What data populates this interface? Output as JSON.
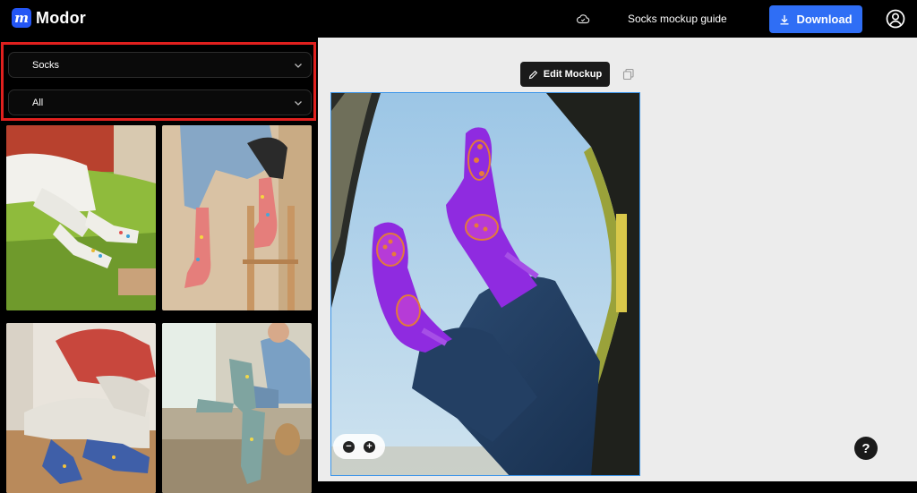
{
  "app": {
    "name": "Modor",
    "logo_letter": "m"
  },
  "header": {
    "cloud_icon": "cloud-icon",
    "guide_label": "Socks mockup guide",
    "download_label": "Download",
    "user_icon": "user-circle-icon"
  },
  "filters": {
    "category": {
      "value": "Socks"
    },
    "subcategory": {
      "value": "All"
    }
  },
  "thumbnails": [
    {
      "name": "mockup-thumbnail-1"
    },
    {
      "name": "mockup-thumbnail-2"
    },
    {
      "name": "mockup-thumbnail-3"
    },
    {
      "name": "mockup-thumbnail-4"
    }
  ],
  "editor": {
    "edit_label": "Edit Mockup",
    "zoom_out": "−",
    "zoom_in": "+",
    "help": "?"
  },
  "colors": {
    "accent": "#2f6ef5",
    "highlight": "#e0201e",
    "selection": "#3b95ea"
  }
}
